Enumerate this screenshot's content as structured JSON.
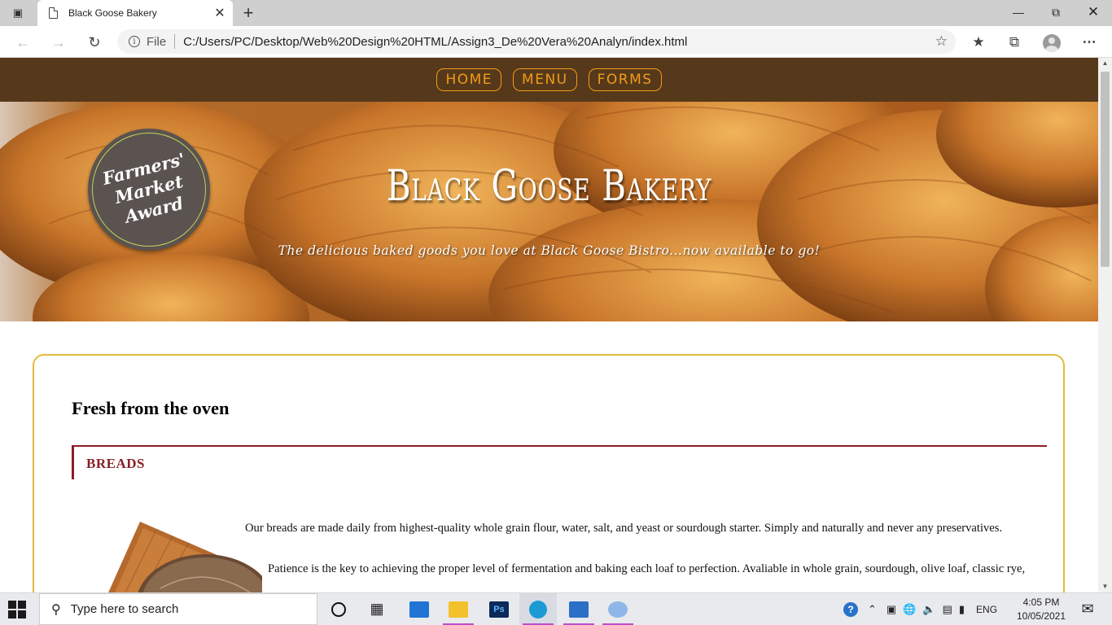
{
  "browser": {
    "tab_title": "Black Goose Bakery",
    "url_scheme": "File",
    "url": "C:/Users/PC/Desktop/Web%20Design%20HTML/Assign3_De%20Vera%20Analyn/index.html"
  },
  "site": {
    "nav": [
      "HOME",
      "MENU",
      "FORMS"
    ],
    "award_lines": [
      "Farmers'",
      "Market",
      "Award"
    ],
    "title": "Black Goose Bakery",
    "subtitle": "The delicious baked goods you love at Black Goose Bistro...now available to go!",
    "section_heading": "Fresh from the oven",
    "category": "BREADS",
    "paragraph1": "Our breads are made daily from highest-quality whole grain flour, water, salt, and yeast or sourdough starter. Simply and naturally and never any preservatives.",
    "paragraph2": "Patience is the key to achieving the proper level of fermentation and baking each loaf to perfection. Avaliable in whole grain, sourdough, olive loaf, classic rye,"
  },
  "taskbar": {
    "search_placeholder": "Type here to search",
    "language": "ENG",
    "time": "4:05 PM",
    "date": "10/05/2021"
  },
  "colors": {
    "nav_bg": "#56391b",
    "nav_accent": "#f29b16",
    "box_border": "#e2bc3c",
    "category_color": "#8a1f25"
  }
}
